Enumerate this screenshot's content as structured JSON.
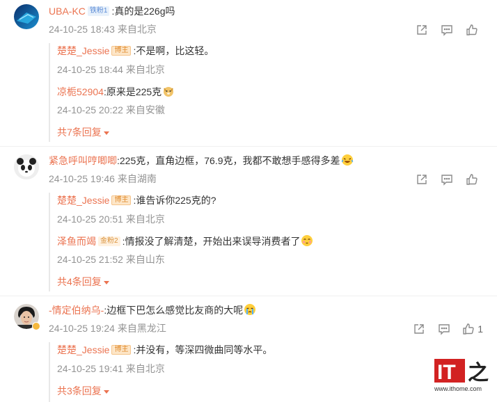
{
  "comments": [
    {
      "user": "UBA-KC",
      "badge": "铁粉1",
      "text": ":真的是226g吗",
      "time": "24-10-25 18:43",
      "location": "来自北京",
      "likes": "",
      "replies": [
        {
          "user": "楚楚_Jessie",
          "badge": "博主",
          "text": ":不是啊，比这轻。",
          "time": "24-10-25 18:44",
          "location": "来自北京"
        },
        {
          "user": "凉栀52904",
          "badge": "",
          "text": ":原来是225克",
          "time": "24-10-25 20:22",
          "location": "来自安徽",
          "emoji": "doge"
        }
      ],
      "more": "共7条回复"
    },
    {
      "user": "紧急呼叫哼唧唧",
      "badge": "",
      "text": ":225克，直角边框，76.9克，我都不敢想手感得多差",
      "time": "24-10-25 19:46",
      "location": "来自湖南",
      "likes": "",
      "emoji": "laugh-cry",
      "replies": [
        {
          "user": "楚楚_Jessie",
          "badge": "博主",
          "text": ":谁告诉你225克的?",
          "time": "24-10-25 20:51",
          "location": "来自北京"
        },
        {
          "user": "泽鱼而竭",
          "badge": "金粉2",
          "text": ":情报没了解清楚，开始出来误导消费者了",
          "time": "24-10-25 21:52",
          "location": "来自山东",
          "emoji": "shy"
        }
      ],
      "more": "共4条回复"
    },
    {
      "user": "-情定伯纳乌-",
      "badge": "",
      "text": ":边框下巴怎么感觉比友商的大呢",
      "time": "24-10-25 19:24",
      "location": "来自黑龙江",
      "likes": "1",
      "emoji": "cry",
      "replies": [
        {
          "user": "楚楚_Jessie",
          "badge": "博主",
          "text": ":并没有，等深四微曲同等水平。",
          "time": "24-10-25 19:41",
          "location": "来自北京"
        }
      ],
      "more": "共3条回复"
    }
  ],
  "watermark": {
    "brand": "IT之家",
    "url": "www.ithome.com"
  },
  "colors": {
    "username": "#eb7350",
    "meta": "#939393",
    "accent_red": "#d22222"
  }
}
